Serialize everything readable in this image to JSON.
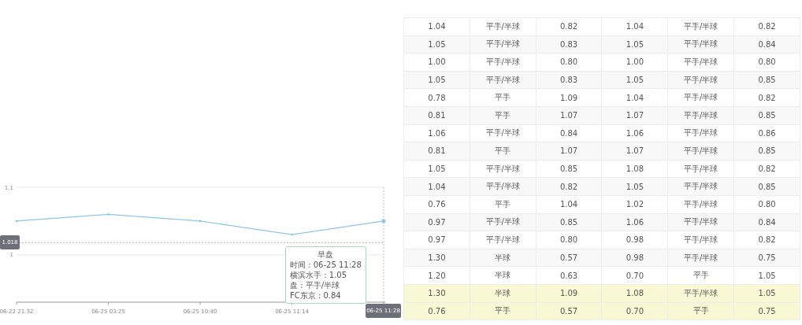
{
  "chart": {
    "chart_data": {
      "type": "line",
      "categories": [
        "06-22 21:32",
        "06-25 03:25",
        "06-25 10:40",
        "06-25 11:14",
        "06-25 11:28"
      ],
      "series": [
        {
          "color": "#8ec6ea",
          "values": [
            1.05,
            1.06,
            1.05,
            1.03,
            1.05
          ]
        }
      ],
      "ylim": [
        0.93,
        1.1
      ],
      "yticks": [
        1,
        1.1
      ],
      "ref_lines": [
        {
          "axis": "y",
          "value": 1.018,
          "label": "1.018"
        },
        {
          "axis": "x",
          "value": "06-25 11:28"
        }
      ]
    },
    "tooltip": {
      "title": "早盘",
      "lines": [
        "时间 : 06-25 11:28",
        "横滨水手 : 1.05",
        "盘 : 平手/半球",
        "FC东京 : 0.84"
      ]
    }
  },
  "table": {
    "rows": [
      {
        "cells": [
          "1.04",
          "平手/半球",
          "0.82",
          "1.04",
          "平手/半球",
          "0.82"
        ],
        "highlighted": false
      },
      {
        "cells": [
          "1.05",
          "平手/半球",
          "0.83",
          "1.05",
          "平手/半球",
          "0.84"
        ],
        "highlighted": false
      },
      {
        "cells": [
          "1.00",
          "平手/半球",
          "0.80",
          "1.00",
          "平手/半球",
          "0.80"
        ],
        "highlighted": false
      },
      {
        "cells": [
          "1.05",
          "平手/半球",
          "0.83",
          "1.05",
          "平手/半球",
          "0.85"
        ],
        "highlighted": false
      },
      {
        "cells": [
          "0.78",
          "平手",
          "1.09",
          "1.04",
          "平手/半球",
          "0.82"
        ],
        "highlighted": false
      },
      {
        "cells": [
          "0.81",
          "平手",
          "1.07",
          "1.07",
          "平手/半球",
          "0.85"
        ],
        "highlighted": false
      },
      {
        "cells": [
          "1.06",
          "平手/半球",
          "0.84",
          "1.06",
          "平手/半球",
          "0.86"
        ],
        "highlighted": false
      },
      {
        "cells": [
          "0.81",
          "平手",
          "1.07",
          "1.07",
          "平手/半球",
          "0.85"
        ],
        "highlighted": false
      },
      {
        "cells": [
          "1.05",
          "平手/半球",
          "0.85",
          "1.08",
          "平手/半球",
          "0.82"
        ],
        "highlighted": false
      },
      {
        "cells": [
          "1.04",
          "平手/半球",
          "0.82",
          "1.05",
          "平手/半球",
          "0.85"
        ],
        "highlighted": false
      },
      {
        "cells": [
          "0.76",
          "平手",
          "1.04",
          "1.02",
          "平手/半球",
          "0.80"
        ],
        "highlighted": false
      },
      {
        "cells": [
          "0.97",
          "平手/半球",
          "0.85",
          "1.06",
          "平手/半球",
          "0.84"
        ],
        "highlighted": false
      },
      {
        "cells": [
          "0.97",
          "平手/半球",
          "0.80",
          "0.98",
          "平手/半球",
          "0.82"
        ],
        "highlighted": false
      },
      {
        "cells": [
          "1.30",
          "半球",
          "0.57",
          "0.98",
          "平手/半球",
          "0.75"
        ],
        "highlighted": false
      },
      {
        "cells": [
          "1.20",
          "半球",
          "0.63",
          "0.70",
          "平手",
          "1.05"
        ],
        "highlighted": false
      },
      {
        "cells": [
          "1.30",
          "半球",
          "1.09",
          "1.08",
          "平手/半球",
          "1.05"
        ],
        "highlighted": true
      },
      {
        "cells": [
          "0.76",
          "平手",
          "0.57",
          "0.70",
          "平手",
          "0.75"
        ],
        "highlighted": true
      }
    ]
  }
}
